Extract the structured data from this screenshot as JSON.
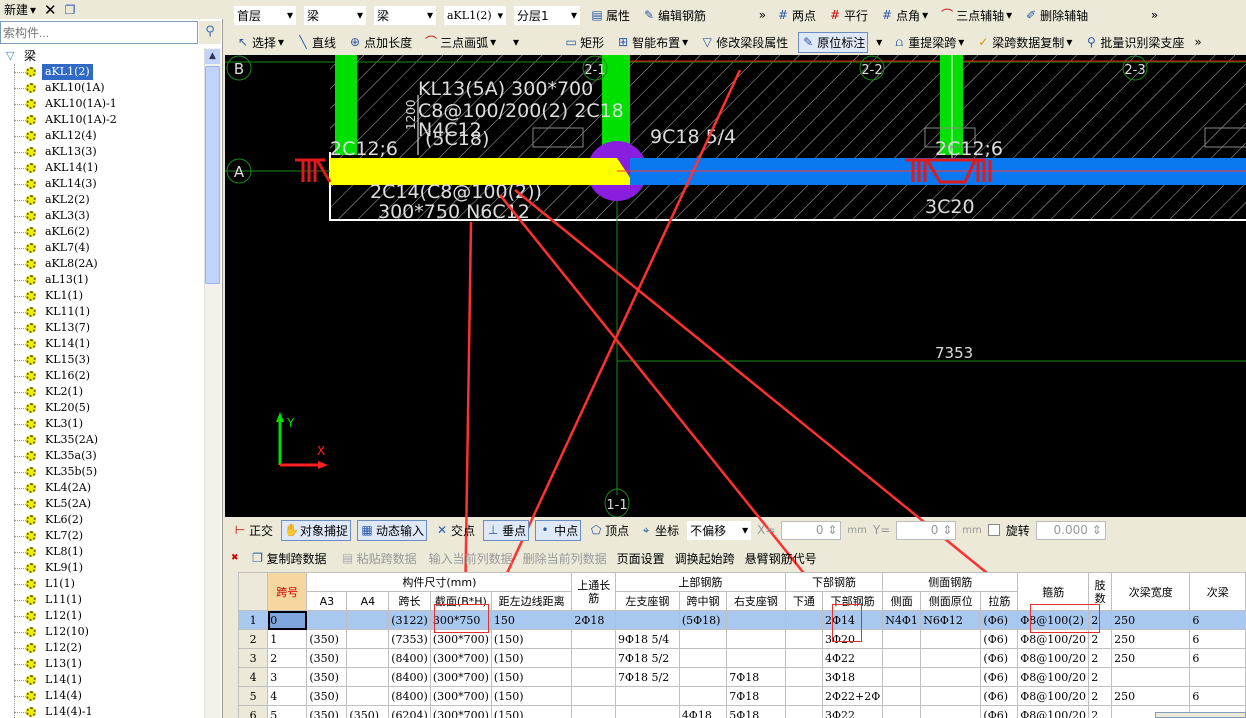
{
  "left_panel": {
    "new_label": "新建",
    "search_placeholder": "索构件...",
    "root": "梁",
    "items": [
      "aKL1(2)",
      "aKL10(1A)",
      "AKL10(1A)-1",
      "AKL10(1A)-2",
      "aKL12(4)",
      "aKL13(3)",
      "AKL14(1)",
      "aKL14(3)",
      "aKL2(2)",
      "aKL3(3)",
      "aKL6(2)",
      "aKL7(4)",
      "aKL8(2A)",
      "aL13(1)",
      "KL1(1)",
      "KL11(1)",
      "KL13(7)",
      "KL14(1)",
      "KL15(3)",
      "KL16(2)",
      "KL2(1)",
      "KL20(5)",
      "KL3(1)",
      "KL35(2A)",
      "KL35a(3)",
      "KL35b(5)",
      "KL4(2A)",
      "KL5(2A)",
      "KL6(2)",
      "KL7(2)",
      "KL8(1)",
      "KL9(1)",
      "L1(1)",
      "L11(1)",
      "L12(1)",
      "L12(10)",
      "L12(2)",
      "L13(1)",
      "L14(1)",
      "L14(4)",
      "L14(4)-1"
    ],
    "selected": "aKL1(2)"
  },
  "toolbar1": {
    "floor": "首层",
    "type1": "梁",
    "type2": "梁",
    "component": "aKL1(2)",
    "layer": "分层1",
    "property": "属性",
    "edit_rebar": "编辑钢筋",
    "two_point": "两点",
    "parallel": "平行",
    "point_angle": "点角",
    "three_point_axis": "三点辅轴",
    "delete_axis": "删除辅轴"
  },
  "toolbar2": {
    "select": "选择",
    "line": "直线",
    "point_length": "点加长度",
    "arc": "三点画弧",
    "rect": "矩形",
    "smart": "智能布置",
    "modify_seg": "修改梁段属性",
    "in_situ": "原位标注",
    "re_extract": "重提梁跨",
    "copy_span": "梁跨数据复制",
    "batch_identify": "批量识别梁支座"
  },
  "canvas": {
    "axis_b": "B",
    "axis_a": "A",
    "axis_21": "2-1",
    "axis_22": "2-2",
    "axis_23": "2-3",
    "axis_11": "1-1",
    "t1": "KL13(5A) 300*700",
    "t2": "C8@100/200(2) 2C18",
    "t3": "N4C12",
    "t4": "(5C18)",
    "t5": "2C12;6",
    "t6": "9C18 5/4",
    "t7": "2C14(C8@100(2))",
    "t8": "300*750 N6C12",
    "t9": "2C12;6",
    "t10": "3C20",
    "t11": "7353",
    "dim": "1200",
    "ax_x": "X",
    "ax_y": "Y",
    "colors": {
      "beam_selected": "#ffff00",
      "beam": "#0a78f0",
      "column": "#00e000",
      "joint": "#8a1ee0",
      "annotation": "#ff3030"
    }
  },
  "snapbar": {
    "ortho": "正交",
    "snap": "对象捕捉",
    "dyn": "动态输入",
    "intersect": "交点",
    "perp": "垂点",
    "mid": "中点",
    "vertex": "顶点",
    "coord": "坐标",
    "offset": "不偏移",
    "x_label": "X=",
    "x_val": "0",
    "y_label": "Y=",
    "y_val": "0",
    "mm": "mm",
    "rotate": "旋转",
    "rotate_val": "0.000"
  },
  "gridbar": {
    "copy": "复制跨数据",
    "paste": "粘贴跨数据",
    "input_col": "输入当前列数据",
    "del_col": "删除当前列数据",
    "page_setup": "页面设置",
    "swap_start": "调换起始跨",
    "cantilever": "悬臂钢筋代号"
  },
  "table": {
    "groups": {
      "span": "跨号",
      "size": "构件尺寸(mm)",
      "top_through": "上通长筋",
      "top": "上部钢筋",
      "bottom": "下部钢筋",
      "side": "侧面钢筋",
      "stirrup": "箍筋",
      "legs": "肢数",
      "sec_width": "次梁宽度",
      "sec": "次梁"
    },
    "sub": [
      "A3",
      "A4",
      "跨长",
      "截面(B*H)",
      "距左边线距离",
      "左支座钢",
      "跨中钢",
      "右支座钢",
      "下通",
      "下部钢筋",
      "侧面",
      "侧面原位",
      "拉筋"
    ],
    "rows": [
      [
        "1",
        "0",
        "",
        "",
        "(3122)",
        "300*750",
        "150",
        "2Φ18",
        "",
        "(5Φ18)",
        "",
        "",
        "2Φ14",
        "N4Φ1",
        "N6Φ12",
        "(Φ6)",
        "Φ8@100(2)",
        "2",
        "250",
        "6"
      ],
      [
        "2",
        "1",
        "(350)",
        "",
        "(7353)",
        "(300*700)",
        "(150)",
        "",
        "9Φ18 5/4",
        "",
        "",
        "",
        "3Φ20",
        "",
        "",
        "(Φ6)",
        "Φ8@100/20",
        "2",
        "250",
        "6"
      ],
      [
        "3",
        "2",
        "(350)",
        "",
        "(8400)",
        "(300*700)",
        "(150)",
        "",
        "7Φ18 5/2",
        "",
        "",
        "",
        "4Φ22",
        "",
        "",
        "(Φ6)",
        "Φ8@100/20",
        "2",
        "250",
        "6"
      ],
      [
        "4",
        "3",
        "(350)",
        "",
        "(8400)",
        "(300*700)",
        "(150)",
        "",
        "7Φ18 5/2",
        "",
        "7Φ18",
        "",
        "3Φ18",
        "",
        "",
        "(Φ6)",
        "Φ8@100/20",
        "2",
        "",
        ""
      ],
      [
        "5",
        "4",
        "(350)",
        "",
        "(8400)",
        "(300*700)",
        "(150)",
        "",
        "",
        "",
        "7Φ18",
        "",
        "2Φ22+2Φ",
        "",
        "",
        "(Φ6)",
        "Φ8@100/20",
        "2",
        "250",
        "6"
      ],
      [
        "6",
        "5",
        "(350)",
        "(350)",
        "(6204)",
        "(300*700)",
        "(150)",
        "",
        "",
        "4Φ18",
        "5Φ18",
        "",
        "3Φ22",
        "",
        "",
        "(Φ6)",
        "Φ8@100/20",
        "2",
        "",
        ""
      ]
    ]
  }
}
